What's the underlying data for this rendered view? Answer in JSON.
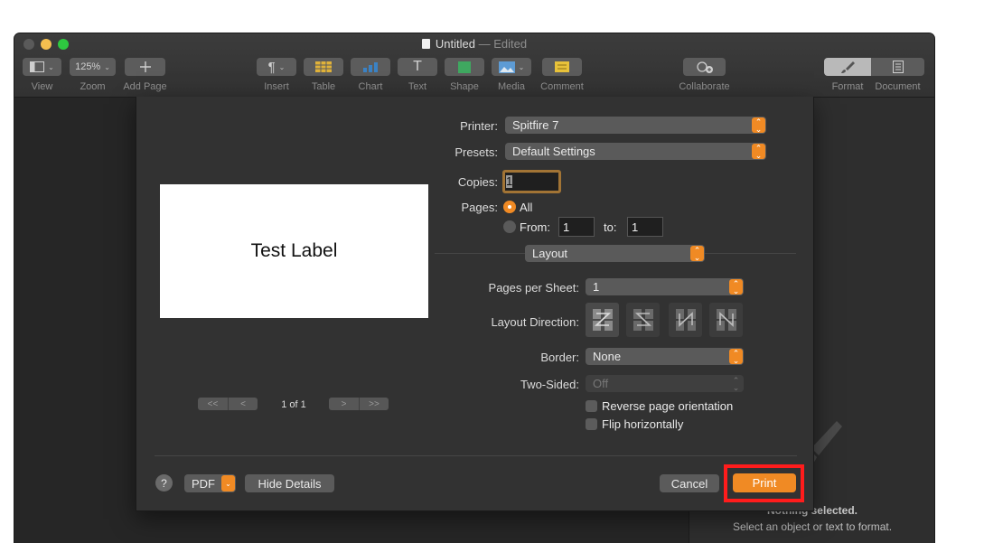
{
  "window": {
    "title": "Untitled",
    "edited": "— Edited"
  },
  "toolbar": {
    "view_label": "View",
    "zoom_value": "125%",
    "zoom_label": "Zoom",
    "add_page_label": "Add Page",
    "insert_label": "Insert",
    "table_label": "Table",
    "chart_label": "Chart",
    "text_label": "Text",
    "shape_label": "Shape",
    "media_label": "Media",
    "comment_label": "Comment",
    "collaborate_label": "Collaborate",
    "format_label": "Format",
    "document_label": "Document",
    "pilcrow": "¶",
    "text_glyph": "T"
  },
  "sidebar": {
    "nothing_selected": "Nothing selected.",
    "hint": "Select an object or text to format."
  },
  "print": {
    "preview_text": "Test Label",
    "page_count": "1 of 1",
    "nav_first": "<<",
    "nav_prev": "<",
    "nav_next": ">",
    "nav_last": ">>",
    "printer_label": "Printer:",
    "printer_value": "Spitfire 7",
    "presets_label": "Presets:",
    "presets_value": "Default Settings",
    "copies_label": "Copies:",
    "copies_value": "1",
    "pages_label": "Pages:",
    "pages_all": "All",
    "pages_from": "From:",
    "from_value": "1",
    "pages_to": "to:",
    "to_value": "1",
    "section_value": "Layout",
    "pages_per_sheet_label": "Pages per Sheet:",
    "pages_per_sheet_value": "1",
    "layout_direction_label": "Layout Direction:",
    "border_label": "Border:",
    "border_value": "None",
    "two_sided_label": "Two-Sided:",
    "two_sided_value": "Off",
    "reverse_label": "Reverse page orientation",
    "flip_label": "Flip horizontally",
    "help": "?",
    "pdf": "PDF",
    "hide_details": "Hide Details",
    "cancel": "Cancel",
    "print_button": "Print"
  },
  "colors": {
    "accent": "#f08a24",
    "highlight": "#ff1c1c"
  }
}
